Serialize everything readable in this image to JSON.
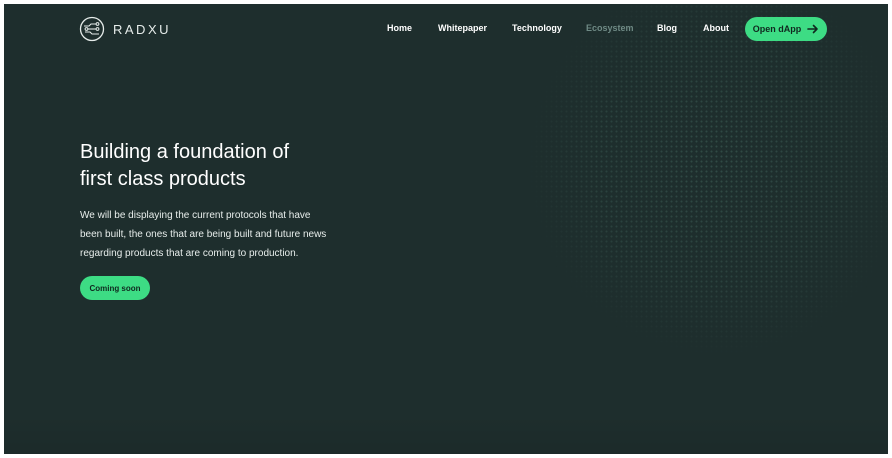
{
  "brand": {
    "name": "RADXU",
    "logo_icon": "circuit-circle-icon"
  },
  "nav": {
    "items": [
      {
        "label": "Home"
      },
      {
        "label": "Whitepaper"
      },
      {
        "label": "Technology"
      },
      {
        "label": "Ecosystem",
        "active": true
      },
      {
        "label": "Blog"
      },
      {
        "label": "About"
      }
    ],
    "cta_label": "Open dApp",
    "cta_icon": "arrow-right-icon"
  },
  "hero": {
    "title_line1": "Building a foundation of",
    "title_line2": "first class products",
    "desc_line1": "We will be displaying the current protocols that have",
    "desc_line2": "been built, the ones that are being built and future news",
    "desc_line3": "regarding products that are coming to production.",
    "button_label": "Coming soon"
  },
  "colors": {
    "background": "#1e2e2d",
    "accent": "#3ddc84",
    "nav_active": "#6f8a85",
    "text": "#ffffff"
  }
}
